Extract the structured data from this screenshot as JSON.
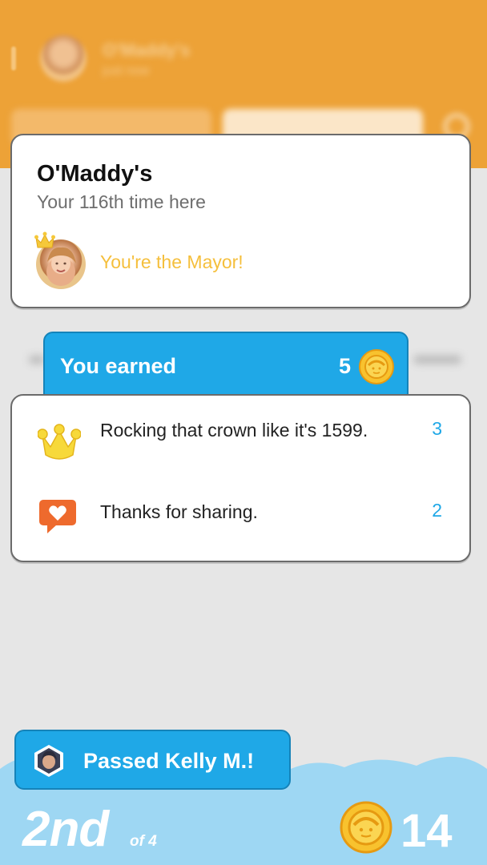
{
  "background": {
    "venue_name": "O'Maddy's",
    "venue_time": "just now",
    "header_color": "#eda237"
  },
  "venue_card": {
    "title": "O'Maddy's",
    "subtitle": "Your 116th time here",
    "mayor_text": "You're the Mayor!",
    "icons": [
      "avatar",
      "crown-icon"
    ]
  },
  "earned": {
    "label": "You earned",
    "total": "5",
    "icon": "coin-icon",
    "accent": "#1fa8e7"
  },
  "earnings": [
    {
      "icon": "crown-icon",
      "text": "Rocking that crown like it's 1599.",
      "points": "3"
    },
    {
      "icon": "heart-speech-bubble-icon",
      "text": "Thanks for sharing.",
      "points": "2"
    }
  ],
  "bottom_bar": {
    "passed_text": "Passed Kelly M.!",
    "rank_place": "2nd",
    "rank_of": "of 4",
    "coin_total": "14",
    "cloud_color": "#9ed7f3"
  }
}
